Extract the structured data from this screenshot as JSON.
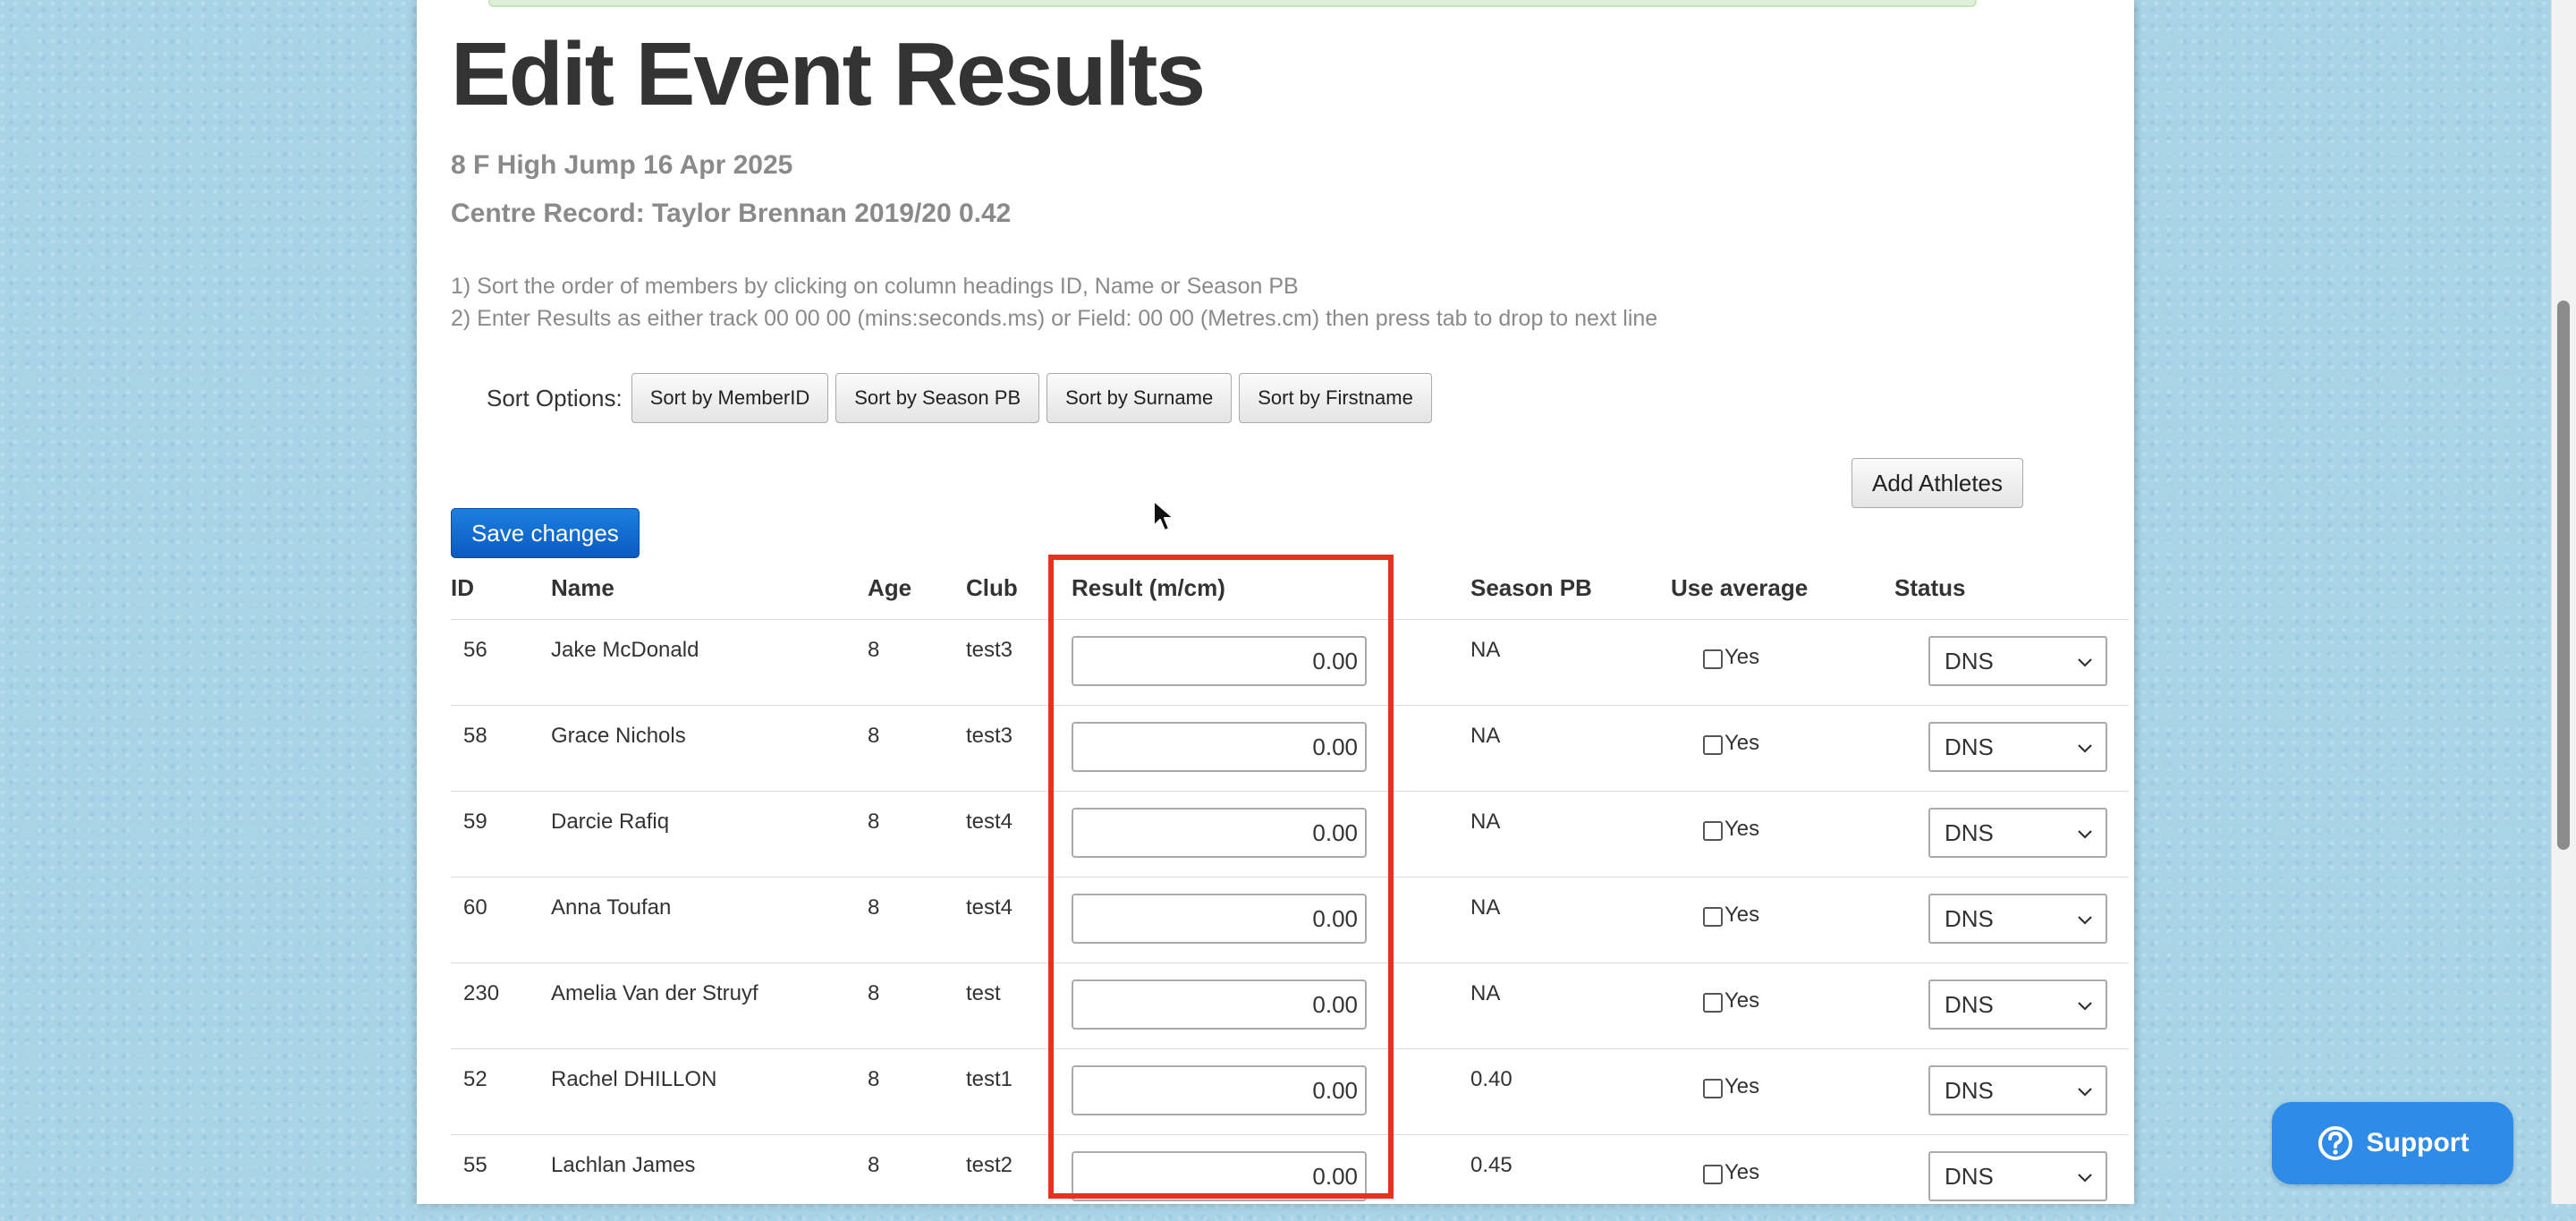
{
  "page_title": "Edit Event Results",
  "event_line": "8 F High Jump 16 Apr 2025",
  "record_line": "Centre Record: Taylor Brennan 2019/20 0.42",
  "instructions": [
    "1) Sort the order of members by clicking on column headings ID, Name or Season PB",
    "2) Enter Results as either track 00 00 00 (mins:seconds.ms) or Field: 00 00 (Metres.cm) then press tab to drop to next line"
  ],
  "sort": {
    "label": "Sort Options:",
    "buttons": [
      "Sort by MemberID",
      "Sort by Season PB",
      "Sort by Surname",
      "Sort by Firstname"
    ]
  },
  "add_athletes_label": "Add Athletes",
  "save_label": "Save changes",
  "columns": {
    "id": "ID",
    "name": "Name",
    "age": "Age",
    "club": "Club",
    "result": "Result (m/cm)",
    "season_pb": "Season PB",
    "use_average": "Use average",
    "status": "Status"
  },
  "rows": [
    {
      "id": "56",
      "name": "Jake McDonald",
      "age": "8",
      "club": "test3",
      "result": "0.00",
      "pb": "NA",
      "avg_label": "Yes",
      "status": "DNS"
    },
    {
      "id": "58",
      "name": "Grace Nichols",
      "age": "8",
      "club": "test3",
      "result": "0.00",
      "pb": "NA",
      "avg_label": "Yes",
      "status": "DNS"
    },
    {
      "id": "59",
      "name": "Darcie Rafiq",
      "age": "8",
      "club": "test4",
      "result": "0.00",
      "pb": "NA",
      "avg_label": "Yes",
      "status": "DNS"
    },
    {
      "id": "60",
      "name": "Anna Toufan",
      "age": "8",
      "club": "test4",
      "result": "0.00",
      "pb": "NA",
      "avg_label": "Yes",
      "status": "DNS"
    },
    {
      "id": "230",
      "name": "Amelia Van der Struyf",
      "age": "8",
      "club": "test",
      "result": "0.00",
      "pb": "NA",
      "avg_label": "Yes",
      "status": "DNS"
    },
    {
      "id": "52",
      "name": "Rachel DHILLON",
      "age": "8",
      "club": "test1",
      "result": "0.00",
      "pb": "0.40",
      "avg_label": "Yes",
      "status": "DNS"
    },
    {
      "id": "55",
      "name": "Lachlan James",
      "age": "8",
      "club": "test2",
      "result": "0.00",
      "pb": "0.45",
      "avg_label": "Yes",
      "status": "DNS"
    }
  ],
  "support_label": "Support",
  "colors": {
    "highlight": "#e8311f",
    "primary_button": "#0a5ac2",
    "support_button": "#2f8be8",
    "background": "#a9d4e8"
  }
}
